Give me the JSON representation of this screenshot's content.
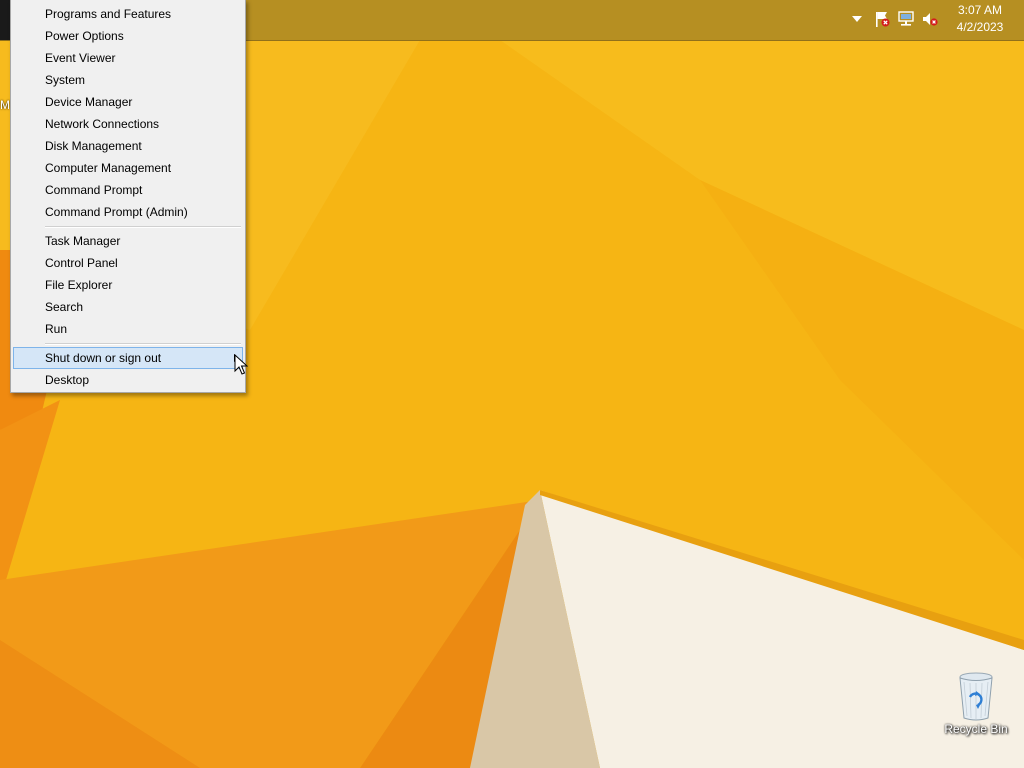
{
  "taskbar": {
    "clock": {
      "time": "3:07 AM",
      "date": "4/2/2023"
    },
    "tray_icons": [
      "show-hidden-icons-arrow-icon",
      "action-center-flag-icon",
      "network-icon",
      "volume-muted-icon"
    ]
  },
  "winx_menu": {
    "groups": [
      {
        "items": [
          {
            "label": "Programs and Features"
          },
          {
            "label": "Power Options"
          },
          {
            "label": "Event Viewer"
          },
          {
            "label": "System"
          },
          {
            "label": "Device Manager"
          },
          {
            "label": "Network Connections"
          },
          {
            "label": "Disk Management"
          },
          {
            "label": "Computer Management"
          },
          {
            "label": "Command Prompt"
          },
          {
            "label": "Command Prompt (Admin)"
          }
        ]
      },
      {
        "items": [
          {
            "label": "Task Manager"
          },
          {
            "label": "Control Panel"
          },
          {
            "label": "File Explorer"
          },
          {
            "label": "Search"
          },
          {
            "label": "Run"
          }
        ]
      },
      {
        "items": [
          {
            "label": "Shut down or sign out",
            "submenu": true,
            "highlighted": true
          },
          {
            "label": "Desktop"
          }
        ]
      }
    ]
  },
  "desktop": {
    "icons": [
      {
        "label": "Recycle Bin",
        "icon": "recycle-bin-icon"
      }
    ],
    "partial_label": "M"
  },
  "colors": {
    "wallpaper_base": "#f6b514",
    "menu_background": "#f0f0f0",
    "menu_highlight": "#d5e6f7",
    "menu_highlight_border": "#7eb4ea"
  }
}
